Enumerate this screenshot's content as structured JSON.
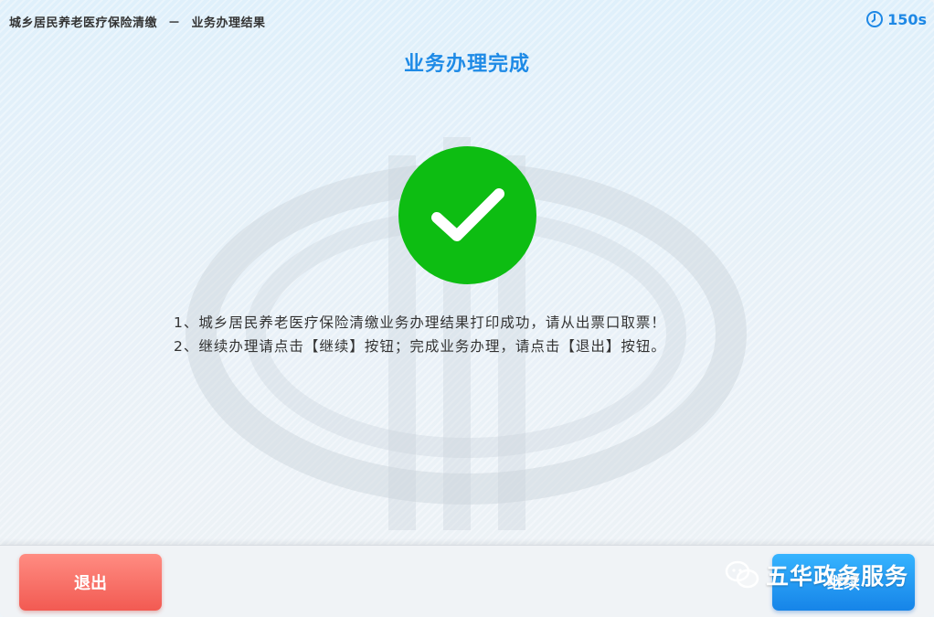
{
  "header": {
    "service_name": "城乡居民养老医疗保险清缴",
    "separator": "－",
    "page_name": "业务办理结果",
    "countdown": "150s"
  },
  "result": {
    "title": "业务办理完成",
    "status_icon": "check-circle-icon",
    "status_color": "#0dbd12",
    "messages": [
      "1、城乡居民养老医疗保险清缴业务办理结果打印成功，请从出票口取票！",
      "2、继续办理请点击【继续】按钮；完成业务办理，请点击【退出】按钮。"
    ]
  },
  "footer": {
    "exit_label": "退出",
    "continue_label": "继续",
    "watermark_text": "五华政务服务"
  },
  "colors": {
    "accent_blue": "#1e8ae6",
    "exit_red": "#f25a52",
    "continue_blue": "#1684e8"
  }
}
